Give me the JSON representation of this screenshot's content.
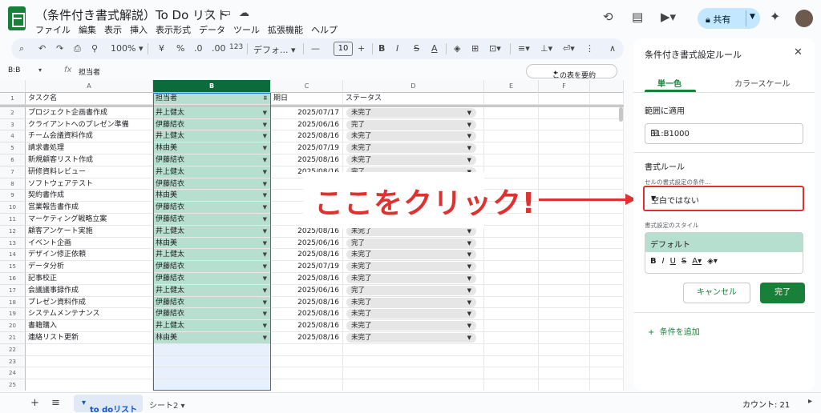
{
  "header": {
    "title": "（条件付き書式解説）To Do リスト",
    "menu": [
      "ファイル",
      "編集",
      "表示",
      "挿入",
      "表示形式",
      "データ",
      "ツール",
      "拡張機能",
      "ヘルプ"
    ],
    "share_label": "共有"
  },
  "toolbar": {
    "zoom": "100%",
    "currency": "¥",
    "percent": "%",
    "dec_dec": ".0",
    "dec_inc": ".00",
    "num_fmt": "123",
    "font": "デフォ...",
    "font_size": "10"
  },
  "formula_bar": {
    "name_box": "B:B",
    "content": "担当者",
    "summarize_label": "この表を要約"
  },
  "grid": {
    "columns": [
      "A",
      "B",
      "C",
      "D",
      "E",
      "F"
    ],
    "header_row": [
      "タスク名",
      "担当者",
      "期日",
      "ステータス"
    ],
    "rows": [
      {
        "n": "2",
        "task": "プロジェクト企画書作成",
        "owner": "井上健太",
        "due": "2025/07/17",
        "status": "未完了"
      },
      {
        "n": "3",
        "task": "クライアントへのプレゼン準備",
        "owner": "伊藤結衣",
        "due": "2025/06/16",
        "status": "完了"
      },
      {
        "n": "4",
        "task": "チーム会議資料作成",
        "owner": "井上健太",
        "due": "2025/08/16",
        "status": "未完了"
      },
      {
        "n": "5",
        "task": "請求書処理",
        "owner": "林由美",
        "due": "2025/07/19",
        "status": "未完了"
      },
      {
        "n": "6",
        "task": "新規顧客リスト作成",
        "owner": "伊藤結衣",
        "due": "2025/08/16",
        "status": "未完了"
      },
      {
        "n": "7",
        "task": "研修資料レビュー",
        "owner": "井上健太",
        "due": "2025/08/16",
        "status": "完了"
      },
      {
        "n": "8",
        "task": "ソフトウェアテスト",
        "owner": "伊藤結衣",
        "due": "",
        "status": ""
      },
      {
        "n": "9",
        "task": "契約書作成",
        "owner": "林由美",
        "due": "",
        "status": ""
      },
      {
        "n": "10",
        "task": "営業報告書作成",
        "owner": "伊藤結衣",
        "due": "",
        "status": ""
      },
      {
        "n": "11",
        "task": "マーケティング戦略立案",
        "owner": "伊藤結衣",
        "due": "",
        "status": ""
      },
      {
        "n": "12",
        "task": "顧客アンケート実施",
        "owner": "井上健太",
        "due": "2025/08/16",
        "status": "未完了"
      },
      {
        "n": "13",
        "task": "イベント企画",
        "owner": "林由美",
        "due": "2025/06/16",
        "status": "完了"
      },
      {
        "n": "14",
        "task": "デザイン修正依頼",
        "owner": "井上健太",
        "due": "2025/08/16",
        "status": "未完了"
      },
      {
        "n": "15",
        "task": "データ分析",
        "owner": "伊藤結衣",
        "due": "2025/07/19",
        "status": "未完了"
      },
      {
        "n": "16",
        "task": "記事校正",
        "owner": "伊藤結衣",
        "due": "2025/08/16",
        "status": "未完了"
      },
      {
        "n": "17",
        "task": "会議議事録作成",
        "owner": "井上健太",
        "due": "2025/06/16",
        "status": "完了"
      },
      {
        "n": "18",
        "task": "プレゼン資料作成",
        "owner": "伊藤結衣",
        "due": "2025/08/16",
        "status": "未完了"
      },
      {
        "n": "19",
        "task": "システムメンテナンス",
        "owner": "伊藤結衣",
        "due": "2025/08/16",
        "status": "未完了"
      },
      {
        "n": "20",
        "task": "書籍購入",
        "owner": "井上健太",
        "due": "2025/08/16",
        "status": "未完了"
      },
      {
        "n": "21",
        "task": "連絡リスト更新",
        "owner": "林由美",
        "due": "2025/08/16",
        "status": "未完了"
      }
    ],
    "empty_rows": [
      "22",
      "23",
      "24",
      "25"
    ]
  },
  "annotation": {
    "callout": "ここをクリック!"
  },
  "tabs": {
    "active": "to doリスト",
    "other": "シート2",
    "count": "カウント: 21"
  },
  "panel": {
    "title": "条件付き書式設定ルール",
    "tab_single": "単一色",
    "tab_scale": "カラースケール",
    "range_label": "範囲に適用",
    "range_value": "B1:B1000",
    "rules_label": "書式ルール",
    "condition_label": "セルの書式設定の条件…",
    "condition_value": "空白ではない",
    "style_label": "書式設定のスタイル",
    "style_preview": "デフォルト",
    "cancel": "キャンセル",
    "done": "完了",
    "add_rule": "条件を追加"
  },
  "colors": {
    "accent": "#188038",
    "callout": "#e03131",
    "highlight": "#b7dfcf"
  }
}
